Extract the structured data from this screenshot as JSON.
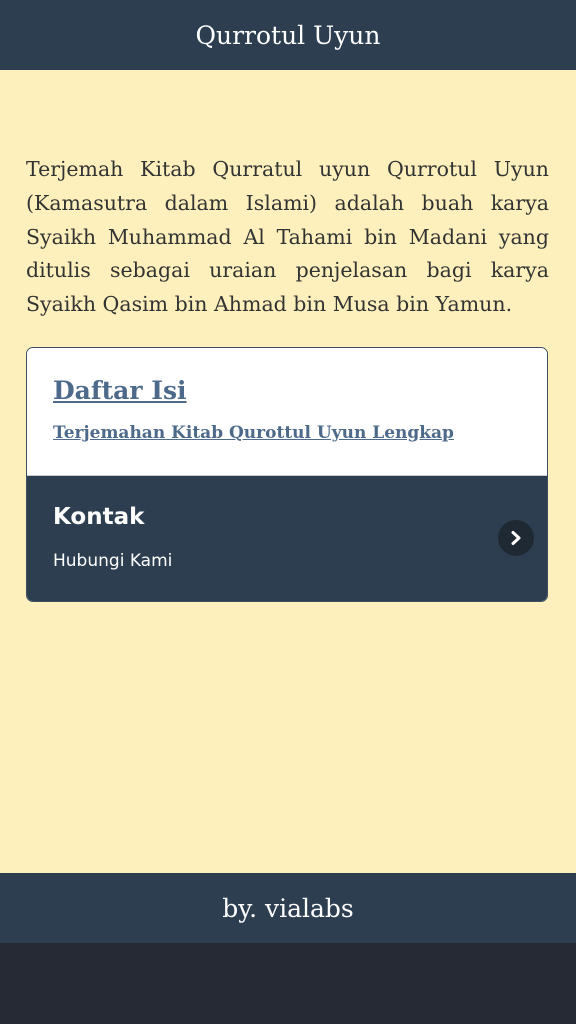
{
  "header": {
    "title": "Qurrotul Uyun"
  },
  "intro": {
    "text": "Terjemah Kitab Qurratul uyun Qurrotul Uyun (Kamasutra dalam Islami) adalah buah karya Syaikh Muhammad Al Tahami bin Madani yang ditulis sebagai uraian penjelasan bagi karya Syaikh Qasim bin Ahmad bin Musa bin Yamun."
  },
  "toc": {
    "title": "Daftar Isi",
    "link": "Terjemahan Kitab Qurottul Uyun Lengkap"
  },
  "contact": {
    "title": "Kontak",
    "subtitle": "Hubungi Kami",
    "icon": "chevron-right-icon"
  },
  "footer": {
    "text": "by. vialabs"
  },
  "colors": {
    "bar": "#2c3e50",
    "background": "#fdf0bd",
    "link": "#4d6a8b"
  }
}
